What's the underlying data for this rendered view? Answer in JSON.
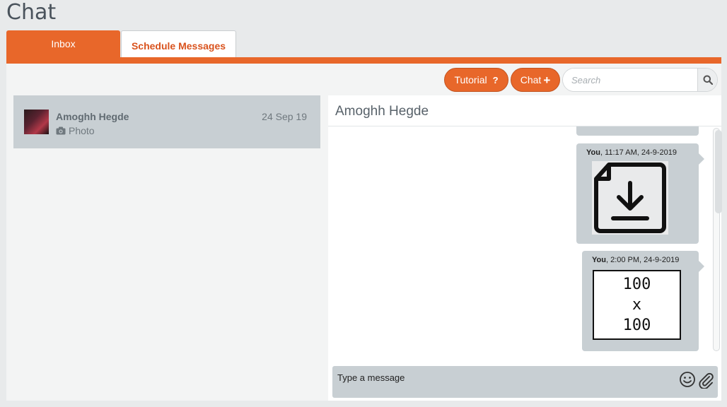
{
  "page": {
    "title": "Chat"
  },
  "tabs": [
    {
      "label": "Inbox",
      "active": true
    },
    {
      "label": "Schedule Messages",
      "active": false
    }
  ],
  "toolbar": {
    "tutorial_label": "Tutorial",
    "tutorial_icon": "?",
    "chat_label": "Chat",
    "chat_icon": "+",
    "search_placeholder": "Search"
  },
  "conversations": [
    {
      "name": "Amoghh Hegde",
      "date": "24 Sep 19",
      "preview": "Photo",
      "preview_icon": "camera-icon"
    }
  ],
  "chat": {
    "header_name": "Amoghh Hegde",
    "messages": [
      {
        "sender": "You",
        "time": ", 11:17 AM, 24-9-2019",
        "type": "file",
        "icon": "file-download-icon"
      },
      {
        "sender": "You",
        "time": ", 2:00 PM, 24-9-2019",
        "type": "image",
        "image_text": [
          "100",
          "x",
          "100"
        ]
      }
    ],
    "composer_placeholder": "Type a message"
  },
  "colors": {
    "accent": "#e8672a",
    "bubble": "#c8cfd3",
    "panel": "#f3f4f4"
  }
}
